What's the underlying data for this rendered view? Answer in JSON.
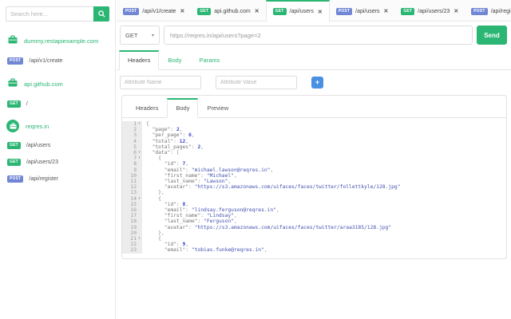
{
  "colors": {
    "accent_green": "#2bb673",
    "post_blue": "#7086d4",
    "add_blue": "#4a90e2"
  },
  "sidebar": {
    "search_placeholder": "Search here...",
    "collections": [
      {
        "name": "dummy.restapiexample.com",
        "active": false,
        "requests": [
          {
            "method": "POST",
            "path": "/api/v1/create"
          }
        ]
      },
      {
        "name": "api.github.com",
        "active": false,
        "requests": [
          {
            "method": "GET",
            "path": "/"
          }
        ]
      },
      {
        "name": "reqres.in",
        "active": true,
        "requests": [
          {
            "method": "GET",
            "path": "/api/users"
          },
          {
            "method": "GET",
            "path": "/api/users/23"
          },
          {
            "method": "POST",
            "path": "/api/register"
          }
        ]
      }
    ]
  },
  "tabbar": {
    "tabs": [
      {
        "method": "POST",
        "label": "/api/v1/create",
        "active": false
      },
      {
        "method": "GET",
        "label": "api.github.com",
        "active": false
      },
      {
        "method": "GET",
        "label": "/api/users",
        "active": true
      },
      {
        "method": "POST",
        "label": "/api/users",
        "active": false
      },
      {
        "method": "GET",
        "label": "/api/users/23",
        "active": false
      },
      {
        "method": "POST",
        "label": "/api/register",
        "active": false
      }
    ],
    "close_glyph": "✕",
    "new_tab_label": "+"
  },
  "request": {
    "method": "GET",
    "url": "https://reqres.in/api/users?page=2",
    "send_label": "Send",
    "tabs": [
      {
        "label": "Headers",
        "active": true
      },
      {
        "label": "Body",
        "active": false
      },
      {
        "label": "Params",
        "active": false
      }
    ],
    "attr_name_placeholder": "Attribute Name",
    "attr_value_placeholder": "Attribute Value",
    "add_label": "+"
  },
  "response": {
    "tabs": [
      {
        "label": "Headers",
        "active": false
      },
      {
        "label": "Body",
        "active": true
      },
      {
        "label": "Preview",
        "active": false
      }
    ],
    "body_lines": [
      {
        "n": 1,
        "fold": true,
        "t": [
          [
            "p",
            "{"
          ]
        ]
      },
      {
        "n": 2,
        "fold": false,
        "t": [
          [
            "p",
            "  "
          ],
          [
            "k",
            "\"page\""
          ],
          [
            "p",
            ": "
          ],
          [
            "n",
            "2"
          ],
          [
            "p",
            ","
          ]
        ]
      },
      {
        "n": 3,
        "fold": false,
        "t": [
          [
            "p",
            "  "
          ],
          [
            "k",
            "\"per_page\""
          ],
          [
            "p",
            ": "
          ],
          [
            "n",
            "6"
          ],
          [
            "p",
            ","
          ]
        ]
      },
      {
        "n": 4,
        "fold": false,
        "t": [
          [
            "p",
            "  "
          ],
          [
            "k",
            "\"total\""
          ],
          [
            "p",
            ": "
          ],
          [
            "n",
            "12"
          ],
          [
            "p",
            ","
          ]
        ]
      },
      {
        "n": 5,
        "fold": false,
        "t": [
          [
            "p",
            "  "
          ],
          [
            "k",
            "\"total_pages\""
          ],
          [
            "p",
            ": "
          ],
          [
            "n",
            "2"
          ],
          [
            "p",
            ","
          ]
        ]
      },
      {
        "n": 6,
        "fold": true,
        "t": [
          [
            "p",
            "  "
          ],
          [
            "k",
            "\"data\""
          ],
          [
            "p",
            ": ["
          ]
        ]
      },
      {
        "n": 7,
        "fold": true,
        "t": [
          [
            "p",
            "    {"
          ]
        ]
      },
      {
        "n": 8,
        "fold": false,
        "t": [
          [
            "p",
            "      "
          ],
          [
            "k",
            "\"id\""
          ],
          [
            "p",
            ": "
          ],
          [
            "n",
            "7"
          ],
          [
            "p",
            ","
          ]
        ]
      },
      {
        "n": 9,
        "fold": false,
        "t": [
          [
            "p",
            "      "
          ],
          [
            "k",
            "\"email\""
          ],
          [
            "p",
            ": "
          ],
          [
            "s",
            "\"michael.lawson@reqres.in\""
          ],
          [
            "p",
            ","
          ]
        ]
      },
      {
        "n": 10,
        "fold": false,
        "t": [
          [
            "p",
            "      "
          ],
          [
            "k",
            "\"first_name\""
          ],
          [
            "p",
            ": "
          ],
          [
            "s",
            "\"Michael\""
          ],
          [
            "p",
            ","
          ]
        ]
      },
      {
        "n": 11,
        "fold": false,
        "t": [
          [
            "p",
            "      "
          ],
          [
            "k",
            "\"last_name\""
          ],
          [
            "p",
            ": "
          ],
          [
            "s",
            "\"Lawson\""
          ],
          [
            "p",
            ","
          ]
        ]
      },
      {
        "n": 12,
        "fold": false,
        "t": [
          [
            "p",
            "      "
          ],
          [
            "k",
            "\"avatar\""
          ],
          [
            "p",
            ": "
          ],
          [
            "s",
            "\"https://s3.amazonaws.com/uifaces/faces/twitter/follettkyle/128.jpg\""
          ]
        ]
      },
      {
        "n": 13,
        "fold": false,
        "t": [
          [
            "p",
            "    },"
          ]
        ]
      },
      {
        "n": 14,
        "fold": true,
        "t": [
          [
            "p",
            "    {"
          ]
        ]
      },
      {
        "n": 15,
        "fold": false,
        "t": [
          [
            "p",
            "      "
          ],
          [
            "k",
            "\"id\""
          ],
          [
            "p",
            ": "
          ],
          [
            "n",
            "8"
          ],
          [
            "p",
            ","
          ]
        ]
      },
      {
        "n": 16,
        "fold": false,
        "t": [
          [
            "p",
            "      "
          ],
          [
            "k",
            "\"email\""
          ],
          [
            "p",
            ": "
          ],
          [
            "s",
            "\"lindsay.ferguson@reqres.in\""
          ],
          [
            "p",
            ","
          ]
        ]
      },
      {
        "n": 17,
        "fold": false,
        "t": [
          [
            "p",
            "      "
          ],
          [
            "k",
            "\"first_name\""
          ],
          [
            "p",
            ": "
          ],
          [
            "s",
            "\"Lindsay\""
          ],
          [
            "p",
            ","
          ]
        ]
      },
      {
        "n": 18,
        "fold": false,
        "t": [
          [
            "p",
            "      "
          ],
          [
            "k",
            "\"last_name\""
          ],
          [
            "p",
            ": "
          ],
          [
            "s",
            "\"Ferguson\""
          ],
          [
            "p",
            ","
          ]
        ]
      },
      {
        "n": 19,
        "fold": false,
        "t": [
          [
            "p",
            "      "
          ],
          [
            "k",
            "\"avatar\""
          ],
          [
            "p",
            ": "
          ],
          [
            "s",
            "\"https://s3.amazonaws.com/uifaces/faces/twitter/araa3185/128.jpg\""
          ]
        ]
      },
      {
        "n": 20,
        "fold": false,
        "t": [
          [
            "p",
            "    },"
          ]
        ]
      },
      {
        "n": 21,
        "fold": true,
        "t": [
          [
            "p",
            "    {"
          ]
        ]
      },
      {
        "n": 22,
        "fold": false,
        "t": [
          [
            "p",
            "      "
          ],
          [
            "k",
            "\"id\""
          ],
          [
            "p",
            ": "
          ],
          [
            "n",
            "9"
          ],
          [
            "p",
            ","
          ]
        ]
      },
      {
        "n": 23,
        "fold": false,
        "t": [
          [
            "p",
            "      "
          ],
          [
            "k",
            "\"email\""
          ],
          [
            "p",
            ": "
          ],
          [
            "s",
            "\"tobias.funke@reqres.in\""
          ],
          [
            "p",
            ","
          ]
        ]
      }
    ]
  }
}
